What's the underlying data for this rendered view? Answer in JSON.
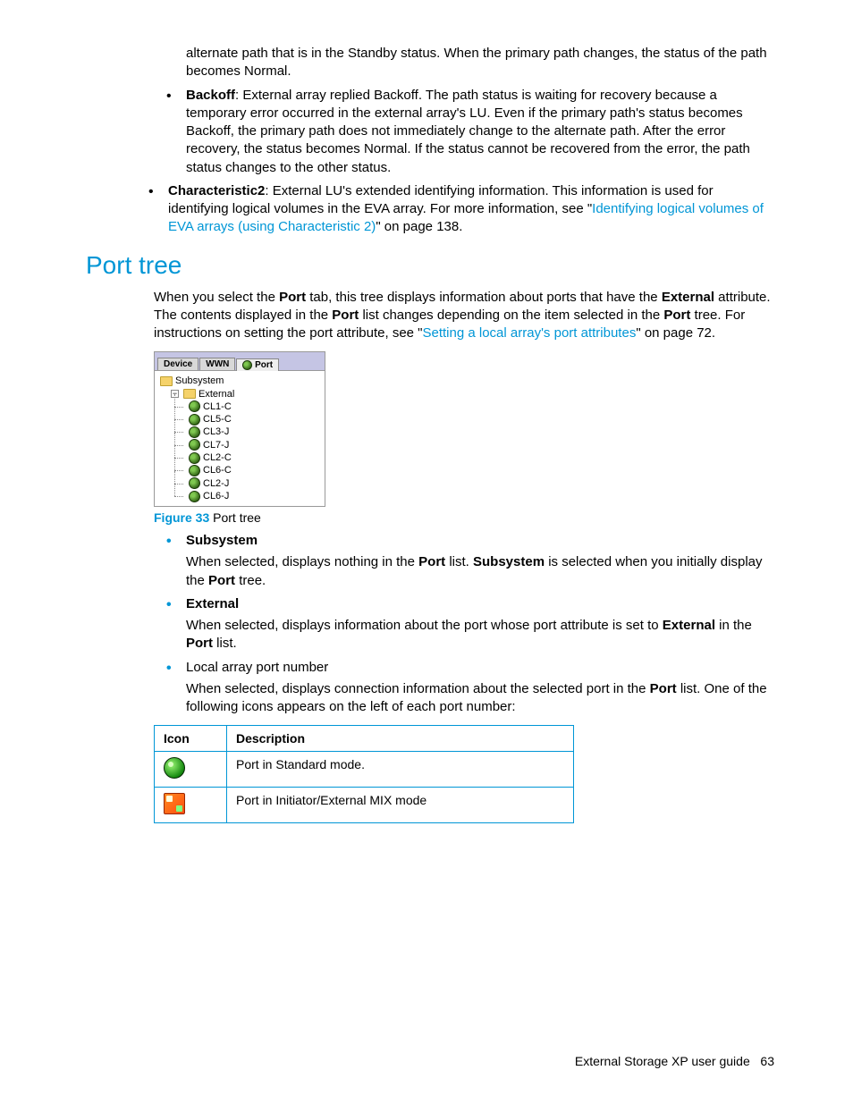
{
  "top": {
    "cont_text": "alternate path that is in the Standby status. When the primary path changes, the status of the path becomes Normal.",
    "bullets": [
      {
        "term": "Backoff",
        "text": ": External array replied Backoff. The path status is waiting for recovery because a temporary error occurred in the external array's LU. Even if the primary path's status becomes Backoff, the primary path does not immediately change to the alternate path. After the error recovery, the status becomes Normal. If the status cannot be recovered from the error, the path status changes to the other status."
      }
    ],
    "char2": {
      "term": "Characteristic2",
      "text_before": ": External LU's extended identifying information. This information is used for identifying logical volumes in the EVA array. For more information, see \"",
      "link": "Identifying logical volumes of EVA arrays (using Characteristic 2)",
      "text_after": "\" on page 138."
    }
  },
  "section_title": "Port tree",
  "intro": {
    "p1_a": "When you select the ",
    "p1_b": "Port",
    "p1_c": " tab, this tree displays information about ports that have the ",
    "p1_d": "External",
    "p1_e": " attribute. The contents displayed in the ",
    "p1_f": "Port",
    "p1_g": " list changes depending on the item selected in the ",
    "p1_h": "Port",
    "p1_i": " tree. For instructions on setting the port attribute, see \"",
    "link": "Setting a local array's port attributes",
    "p1_j": "\" on page 72."
  },
  "figure": {
    "tabs": [
      "Device",
      "WWN",
      "Port"
    ],
    "tree": {
      "root": "Subsystem",
      "external": "External",
      "ports": [
        "CL1-C",
        "CL5-C",
        "CL3-J",
        "CL7-J",
        "CL2-C",
        "CL6-C",
        "CL2-J",
        "CL6-J"
      ]
    },
    "caption_num": "Figure 33",
    "caption_text": " Port tree"
  },
  "defs": [
    {
      "term": "Subsystem",
      "bold": true,
      "desc_a": "When selected, displays nothing in the ",
      "desc_b": "Port",
      "desc_c": " list. ",
      "desc_d": "Subsystem",
      "desc_e": " is selected when you initially display the ",
      "desc_f": "Port",
      "desc_g": " tree."
    },
    {
      "term": "External",
      "bold": true,
      "desc_a": "When selected, displays information about the port whose port attribute is set to ",
      "desc_b": "External",
      "desc_c": " in the ",
      "desc_d": "Port",
      "desc_e": " list.",
      "desc_f": "",
      "desc_g": ""
    },
    {
      "term": "Local array port number",
      "bold": false,
      "desc_a": "When selected, displays connection information about the selected port in the ",
      "desc_b": "Port",
      "desc_c": " list. One of the following icons appears on the left of each port number:",
      "desc_d": "",
      "desc_e": "",
      "desc_f": "",
      "desc_g": ""
    }
  ],
  "table": {
    "head_icon": "Icon",
    "head_desc": "Description",
    "rows": [
      {
        "desc": "Port in Standard mode."
      },
      {
        "desc": "Port in Initiator/External MIX mode"
      }
    ]
  },
  "footer": {
    "text": "External Storage XP user guide",
    "page": "63"
  }
}
